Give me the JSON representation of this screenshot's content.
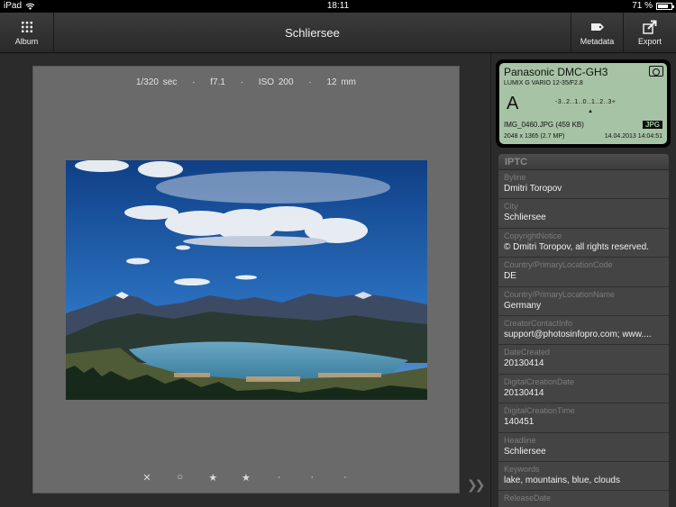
{
  "status_bar": {
    "device": "iPad",
    "time": "18:11",
    "battery": "71 %",
    "battery_level": 0.71
  },
  "nav": {
    "title": "Schliersee",
    "album_label": "Album",
    "metadata_label": "Metadata",
    "export_label": "Export"
  },
  "exif": {
    "shutter": "1/320 sec",
    "aperture": "f7.1",
    "iso": "ISO 200",
    "focal": "12 mm",
    "separator": "·"
  },
  "rating": {
    "reject": "✕",
    "clear": "○",
    "star1": "★",
    "star2": "★",
    "star3": "·",
    "star4": "·",
    "star5": "·",
    "stars": 2
  },
  "lcd": {
    "camera": "Panasonic DMC-GH3",
    "lens": "LUMIX G VARIO 12-35/F2.8",
    "mode": "A",
    "scale": "-3..2..1..0..1..2..3+",
    "marker": "▲",
    "file": "IMG_0460.JPG (459 KB)",
    "format": "JPG",
    "resolution": "2048 x 1365 (2.7 MP)",
    "date": "14.04.2013 14:04:51"
  },
  "iptc": {
    "header": "IPTC",
    "rows": [
      {
        "key": "Byline",
        "value": "Dmitri Toropov"
      },
      {
        "key": "City",
        "value": "Schliersee"
      },
      {
        "key": "CopyrightNotice",
        "value": "© Dmitri Toropov, all rights reserved."
      },
      {
        "key": "Country/PrimaryLocationCode",
        "value": "DE"
      },
      {
        "key": "Country/PrimaryLocationName",
        "value": "Germany"
      },
      {
        "key": "CreatorContactInfo",
        "value": "support@photosinfopro.com; www...."
      },
      {
        "key": "DateCreated",
        "value": "20130414"
      },
      {
        "key": "DigitalCreationDate",
        "value": "20130414"
      },
      {
        "key": "DigitalCreationTime",
        "value": "140451"
      },
      {
        "key": "Headline",
        "value": "Schliersee"
      },
      {
        "key": "Keywords",
        "value": "lake, mountains, blue, clouds"
      },
      {
        "key": "ReleaseDate",
        "value": ""
      }
    ]
  },
  "colors": {
    "lcd_bg": "#a7c3a5",
    "panel_bg": "#6a6a6a",
    "sky": "#1f5fa8",
    "lake": "#4f8fb0"
  }
}
